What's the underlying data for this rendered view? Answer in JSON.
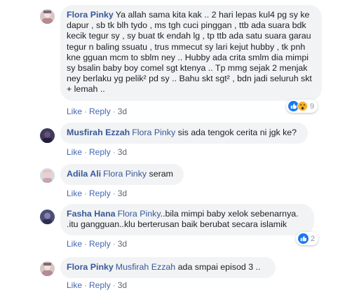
{
  "comments": [
    {
      "author": "Flora Pinky",
      "mention": "",
      "text": "Ya allah sama kita kak .. 2 hari lepas kul4 pg sy ke dapur , sb tk blh tydo , ms tgh cuci pinggan , ttb ada suara bdk kecik tegur sy , sy buat tk endah lg , tp ttb ada satu suara garau tegur n baling ssuatu , trus mmecut sy lari kejut hubby , tk pnh kne gguan mcm to sblm ney .. Hubby ada crita smlm dia mimpi sy bsalin baby boy comel sgt ktenya .. Tp mmg sejak 2 menjak ney berlaku yg pelik² pd sy .. Bahu skt sgt² , bdn jadi seluruh skt + lemah ..",
      "like": "Like",
      "reply": "Reply",
      "time": "3d",
      "reactions": "9",
      "reaction_icons": [
        "like-icon",
        "wow-icon"
      ]
    },
    {
      "author": "Musfirah Ezzah",
      "mention": "Flora Pinky",
      "text": "sis ada tengok cerita ni jgk ke?",
      "like": "Like",
      "reply": "Reply",
      "time": "3d"
    },
    {
      "author": "Adila Ali",
      "mention": "Flora Pinky",
      "text": "seram",
      "like": "Like",
      "reply": "Reply",
      "time": "3d"
    },
    {
      "author": "Fasha Hana",
      "mention": "Flora Pinky",
      "text": "..bila mimpi baby xelok sebenarnya. .itu gangguan..klu berterusan baik berubat secara islamik",
      "like": "Like",
      "reply": "Reply",
      "time": "3d",
      "reactions": "2",
      "reaction_icons": [
        "like-icon"
      ]
    },
    {
      "author": "Flora Pinky",
      "mention": "Musfirah Ezzah",
      "text": "ada smpai episod 3 ..",
      "like": "Like",
      "reply": "Reply",
      "time": "3d"
    }
  ],
  "colors": {
    "link": "#385898",
    "action": "#4267b2",
    "bubble": "#f2f3f5",
    "like_blue": "#1877f2",
    "wow_yellow": "#f7b125"
  }
}
